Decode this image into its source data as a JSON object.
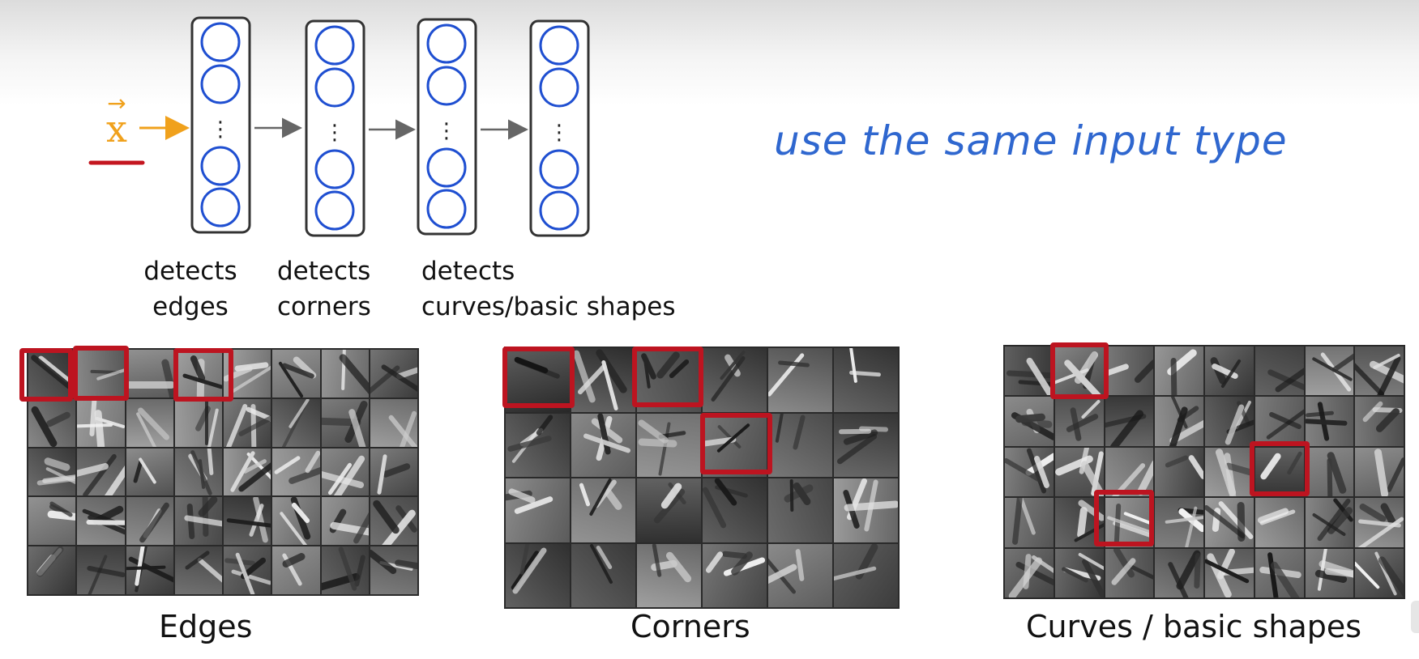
{
  "network": {
    "input_symbol": "x",
    "vector_arrow": "→",
    "ellipsis": "⋮",
    "layer_count": 4
  },
  "layer_labels": [
    {
      "line1": "detects",
      "line2": "edges"
    },
    {
      "line1": "detects",
      "line2": "corners"
    },
    {
      "line1": "detects",
      "line2": "curves/basic shapes"
    }
  ],
  "annotation": {
    "text": "use the same input type",
    "color": "#2f67cf"
  },
  "panels": [
    {
      "caption": "Edges",
      "rows": 5,
      "cols": 8
    },
    {
      "caption": "Corners",
      "rows": 4,
      "cols": 6
    },
    {
      "caption": "Curves / basic shapes",
      "rows": 5,
      "cols": 8
    }
  ],
  "colors": {
    "input": "#f0a11c",
    "underline": "#c4161f",
    "neuron": "#1f4fd1",
    "highlight": "#bd1420",
    "connector": "#666666"
  },
  "icons": [
    "right-arrow-icon",
    "vector-arrow-icon",
    "neuron-circle-icon"
  ]
}
